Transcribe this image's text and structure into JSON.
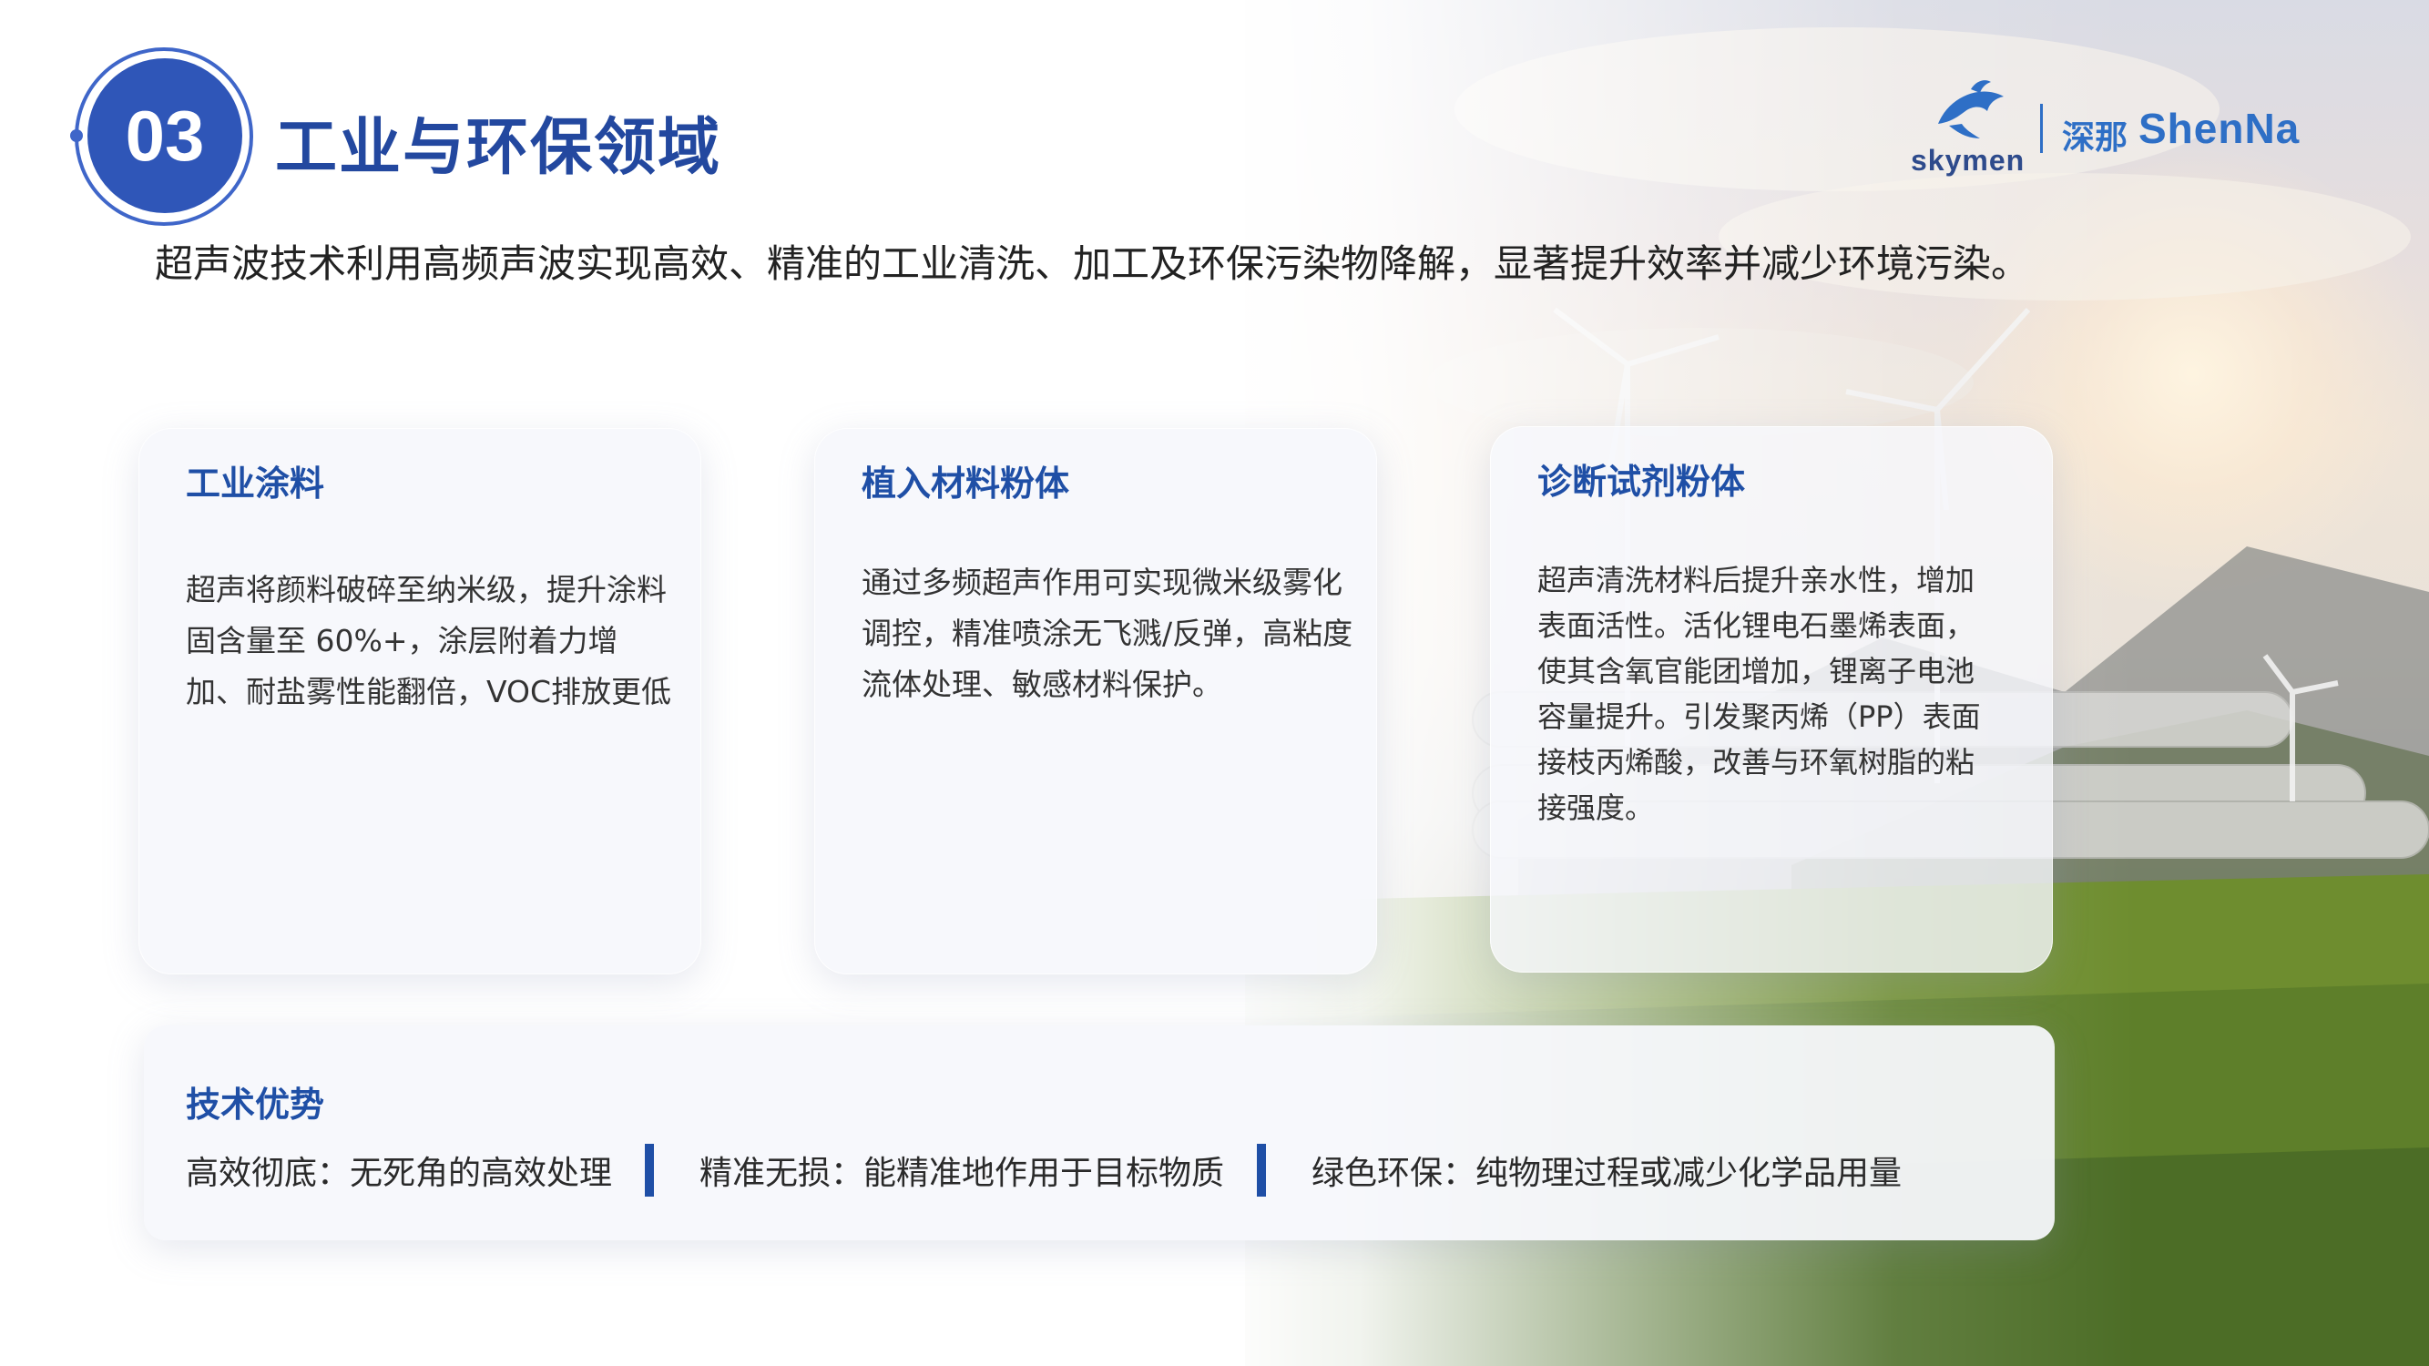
{
  "section": {
    "number": "03",
    "title": "工业与环保领域"
  },
  "logo": {
    "brand_en": "skymen",
    "brand_cn": "深那",
    "brand_pinyin": "ShenNa",
    "icon": "dolphin-icon"
  },
  "intro": "超声波技术利用高频声波实现高效、精准的工业清洗、加工及环保污染物降解，显著提升效率并减少环境污染。",
  "cards": [
    {
      "title": "工业涂料",
      "body": "超声将颜料破碎至纳米级，提升涂料固含量至 60%+，涂层附着力增加、耐盐雾性能翻倍，VOC排放更低"
    },
    {
      "title": "植入材料粉体",
      "body": "通过多频超声作用可实现微米级雾化调控，精准喷涂无飞溅/反弹，高粘度流体处理、敏感材料保护。"
    },
    {
      "title": "诊断试剂粉体",
      "body": "超声清洗材料后提升亲水性，增加表面活性。活化锂电石墨烯表面，使其含氧官能团增加，锂离子电池容量提升。引发聚丙烯（PP）表面接枝丙烯酸，改善与环氧树脂的粘接强度。"
    }
  ],
  "advantages": {
    "title": "技术优势",
    "items": [
      "高效彻底：无死角的高效处理",
      "精准无损：能精准地作用于目标物质",
      "绿色环保：纯物理过程或减少化学品用量"
    ]
  },
  "colors": {
    "accent": "#2f56b8",
    "title_blue": "#1f4fa6",
    "logo_blue": "#2e6fc6"
  }
}
